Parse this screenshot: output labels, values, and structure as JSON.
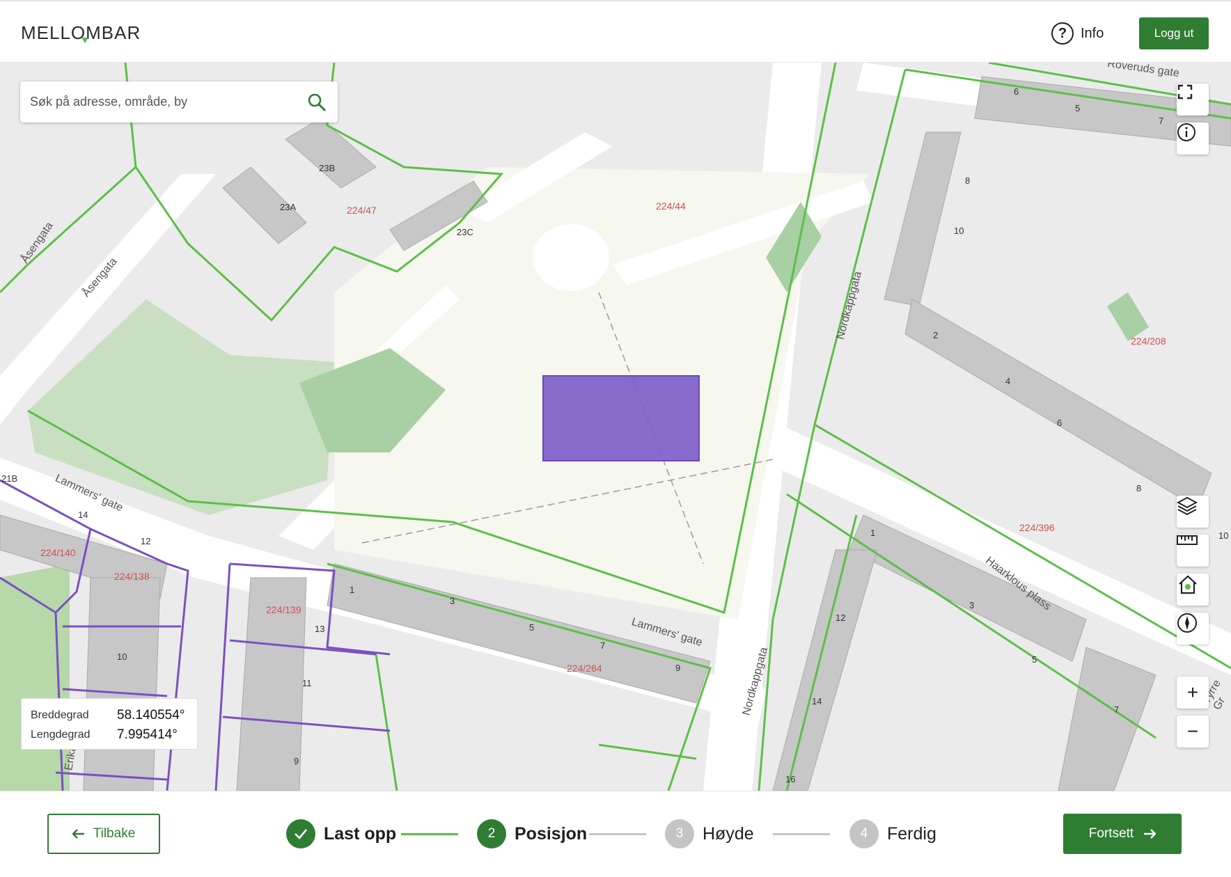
{
  "header": {
    "logo": "MELLOMBAR",
    "info_label": "Info",
    "logout_label": "Logg ut"
  },
  "search": {
    "placeholder": "Søk på adresse, område, by"
  },
  "map": {
    "streets": [
      "Roveruds gate",
      "Åsengata",
      "Åsengata",
      "Lammers' gate",
      "Lammers' gate",
      "Nordkappgata",
      "Nordkappgata",
      "Haarklous plass",
      "Erika",
      "Tyrre Gr"
    ],
    "parcels": [
      "224/47",
      "224/44",
      "224/208",
      "224/140",
      "224/138",
      "224/139",
      "224/264",
      "224/396"
    ],
    "addresses": [
      "23B",
      "23A",
      "23C",
      "6",
      "5",
      "7",
      "8",
      "10",
      "2",
      "4",
      "6",
      "8",
      "10",
      "21B",
      "14",
      "12",
      "10",
      "1",
      "3",
      "5",
      "7",
      "9",
      "13",
      "11",
      "9",
      "1",
      "12",
      "14",
      "16",
      "3",
      "5",
      "7"
    ],
    "colors": {
      "property_line": "#5cbf47",
      "selected_property_line": "#7b4fc4",
      "placed_object": "#7d5ec9",
      "building": "#c7c7c7",
      "park": "#f6f7ef",
      "green_area": "#c9dfc1"
    }
  },
  "controls": {
    "fullscreen_icon": "fullscreen-icon",
    "info_icon": "info-icon",
    "layers_icon": "layers-icon",
    "ruler_icon": "ruler-icon",
    "home_icon": "home-pin-icon",
    "compass_icon": "compass-icon",
    "zoom_in": "+",
    "zoom_out": "−"
  },
  "coordinates": {
    "lat_label": "Breddegrad",
    "lat_value": "58.140554°",
    "lon_label": "Lengdegrad",
    "lon_value": "7.995414°"
  },
  "footer": {
    "back_label": "Tilbake",
    "next_label": "Fortsett",
    "steps": [
      {
        "number": "✓",
        "label": "Last opp",
        "state": "done"
      },
      {
        "number": "2",
        "label": "Posisjon",
        "state": "active"
      },
      {
        "number": "3",
        "label": "Høyde",
        "state": "pending"
      },
      {
        "number": "4",
        "label": "Ferdig",
        "state": "pending"
      }
    ],
    "colors": {
      "done": "#2e7d32",
      "pending": "#c4c4c4",
      "line_done": "#5cbf47",
      "line_pending": "#c4c4c4"
    }
  }
}
